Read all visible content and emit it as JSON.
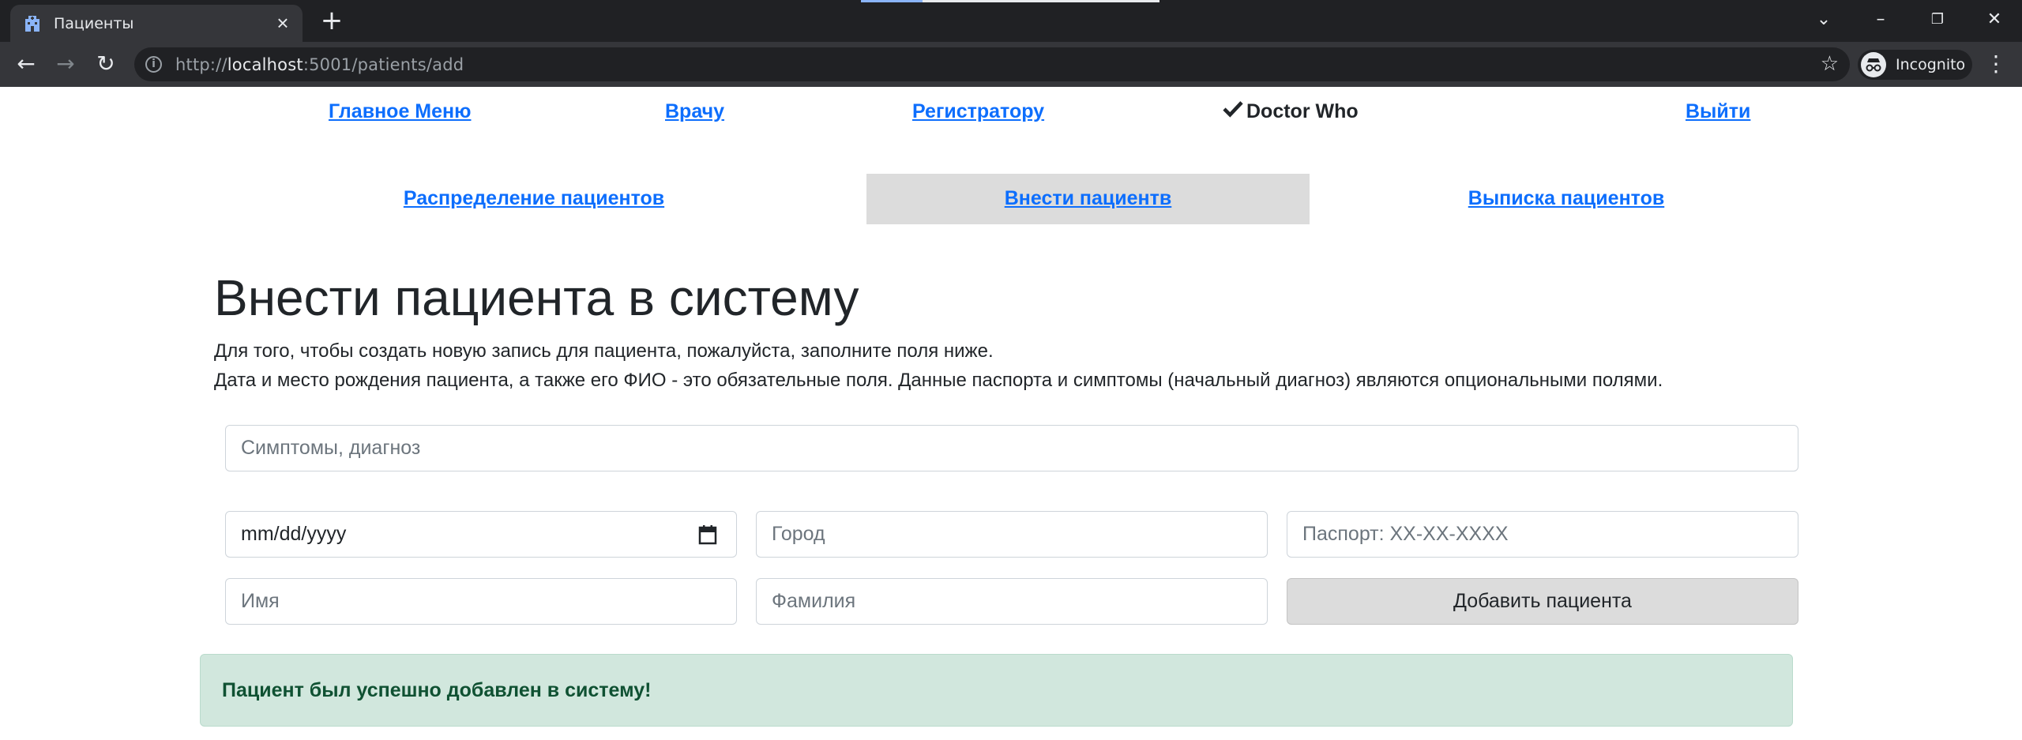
{
  "browser": {
    "tab_title": "Пациенты",
    "url_scheme": "http://",
    "url_host": "localhost",
    "url_path": ":5001/patients/add",
    "profile_label": "Incognito"
  },
  "nav": {
    "main_menu": "Главное Меню",
    "doctor": "Врачу",
    "registrar": "Регистратору",
    "user_name": "Doctor Who",
    "logout": "Выйти"
  },
  "subnav": {
    "distribution": "Распределение пациентов",
    "add_patient": "Внести пациентв",
    "discharge": "Выписка пациентов",
    "active": "add_patient"
  },
  "content": {
    "title": "Внести пациента в систему",
    "desc_line1": "Для того, чтобы создать новую запись для пациента, пожалуйста, заполните поля ниже.",
    "desc_line2": "Дата и место рождения пациента, а также его ФИО - это обязательные поля. Данные паспорта и симптомы (начальный диагноз) являются опциональными полями."
  },
  "form": {
    "symptoms_placeholder": "Симптомы, диагноз",
    "date_value": "mm/dd/yyyy",
    "city_placeholder": "Город",
    "passport_placeholder": "Паспорт: XX-XX-XXXX",
    "first_name_placeholder": "Имя",
    "last_name_placeholder": "Фамилия",
    "submit_label": "Добавить пациента"
  },
  "alert": {
    "message": "Пациент был успешно добавлен в систему!"
  },
  "colors": {
    "link": "#0d6efd",
    "active_tab_bg": "#dcdcdc",
    "alert_bg": "#d1e7dd",
    "alert_text": "#0f5132"
  }
}
